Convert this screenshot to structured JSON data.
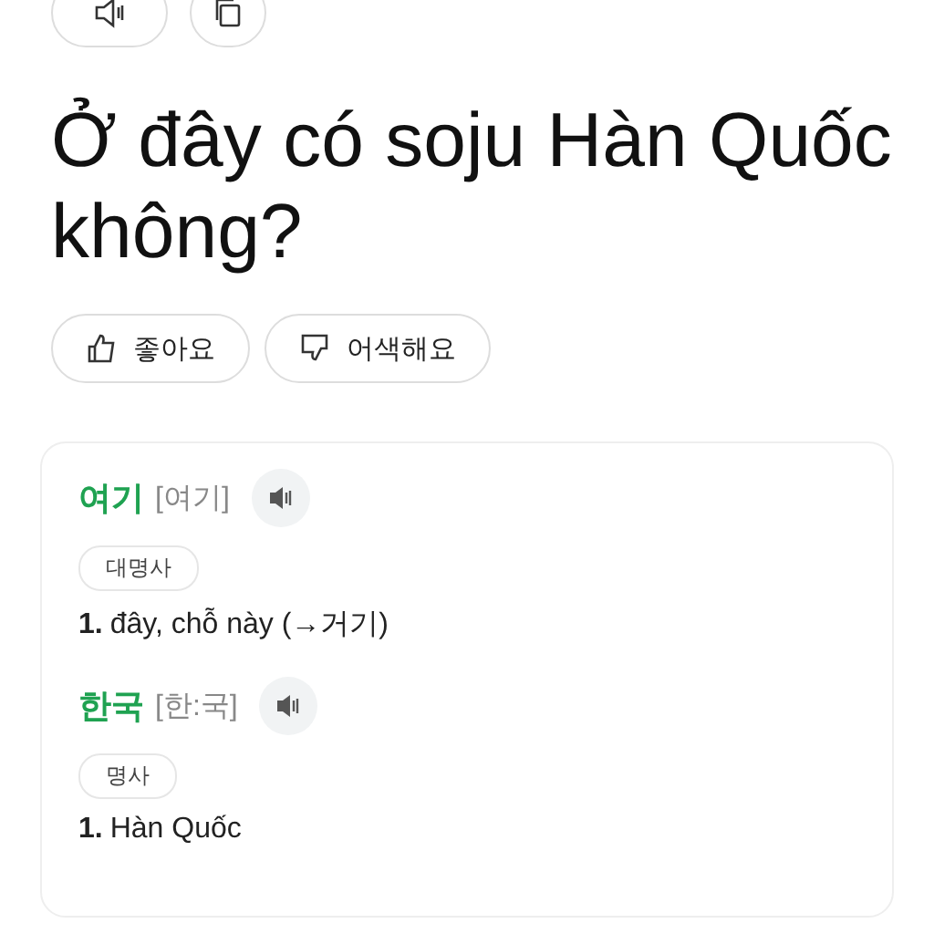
{
  "top_actions": [
    {
      "kind": "speaker"
    },
    {
      "kind": "copy"
    }
  ],
  "sentence": "Ở đây có soju Hàn Quốc không?",
  "feedback": [
    {
      "kind": "like",
      "label": "좋아요"
    },
    {
      "kind": "dislike",
      "label": "어색해요"
    }
  ],
  "entries": [
    {
      "word": "여기",
      "pronunciation": "[여기]",
      "pos": "대명사",
      "senses": [
        {
          "number": "1.",
          "text": "đây, chỗ này (→거기)"
        }
      ]
    },
    {
      "word": "한국",
      "pronunciation": "[한:국]",
      "pos": "명사",
      "senses": [
        {
          "number": "1.",
          "text": "Hàn Quốc"
        }
      ]
    }
  ]
}
